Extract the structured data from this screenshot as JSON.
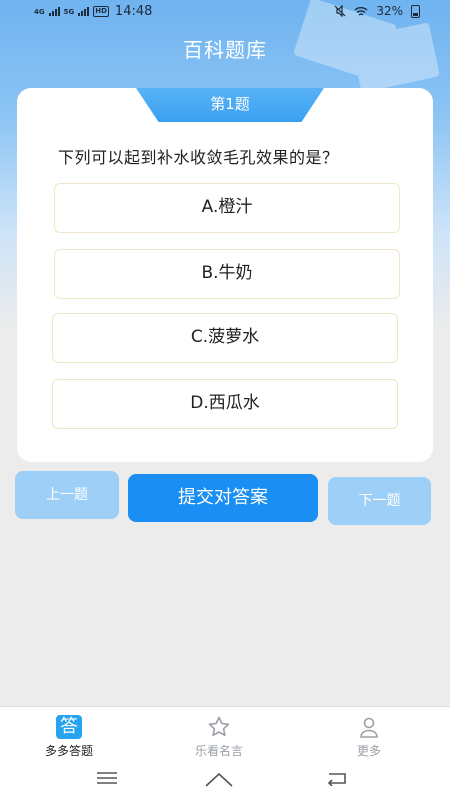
{
  "status_bar": {
    "sim1": "4G",
    "sim2": "5G",
    "hd": "HD",
    "time": "14:48",
    "battery": "32%",
    "icons": [
      "mute-icon",
      "wifi-icon",
      "battery-icon"
    ]
  },
  "header": {
    "title": "百科题库"
  },
  "quiz": {
    "number_label": "第1题",
    "question": "下列可以起到补水收敛毛孔效果的是？",
    "options": [
      "A.橙汁",
      "B.牛奶",
      "C.菠萝水",
      "D.西瓜水"
    ]
  },
  "buttons": {
    "prev": "上一题",
    "submit": "提交对答案",
    "next": "下一题"
  },
  "tabbar": {
    "tabs": [
      {
        "label": "多多答题",
        "icon": "答",
        "active": true
      },
      {
        "label": "乐看名言",
        "icon": "star-icon",
        "active": false
      },
      {
        "label": "更多",
        "icon": "person-icon",
        "active": false
      }
    ]
  },
  "colors": {
    "accent": "#1a8ef2",
    "secondary_button": "#9ecff7",
    "header_gradient_top": "#6fb3f0",
    "tab_icon": "#27a3f0"
  }
}
